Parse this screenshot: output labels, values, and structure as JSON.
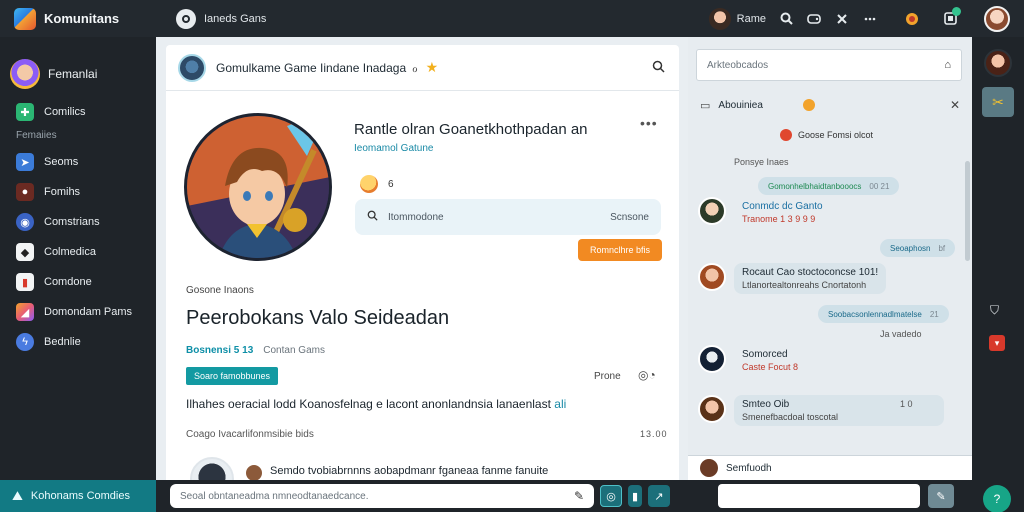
{
  "app": {
    "name": "Komunitans"
  },
  "top_tab": {
    "label": "Ianeds Gans"
  },
  "top_user": {
    "name": "Rame"
  },
  "top_icons": [
    "search-icon",
    "gamepad-icon",
    "share-icon",
    "grid-icon",
    "coin-icon",
    "notification-icon"
  ],
  "sidebar": {
    "profile_name": "Femanlai",
    "items": [
      {
        "label": "Comilics",
        "icon": "puzzle-icon",
        "color": "#2bb673"
      },
      {
        "section": "Femaiies"
      },
      {
        "label": "Seoms",
        "icon": "cursor-icon",
        "color": "#3b7bd8"
      },
      {
        "label": "Fomihs",
        "icon": "person-icon",
        "color": "#c0392b"
      },
      {
        "label": "Comstrians",
        "icon": "globe-icon",
        "color": "#3a63c4"
      },
      {
        "label": "Colmedica",
        "icon": "dice-icon",
        "color": "#f2f4f5"
      },
      {
        "label": "Comdone",
        "icon": "card-icon",
        "color": "#f2f4f5"
      },
      {
        "label": "Domondam Pams",
        "icon": "palette-icon",
        "color": "#e85d75"
      },
      {
        "label": "Bednlie",
        "icon": "bolt-icon",
        "color": "#4a7be0"
      }
    ]
  },
  "left_bottom": {
    "label": "Kohonams Comdies"
  },
  "card": {
    "header_title": "Gomulkame Game Iindane Inadaga",
    "game_title": "Rantle olran Goanetkhothpadan an",
    "game_subtitle": "Ieomamol Gatune",
    "reaction_count": "6",
    "search_placeholder": "Itommodone",
    "search_action": "Scnsone",
    "orange_button": "Romnclhre bfis",
    "section_label": "Gosone Inaons",
    "heading": "Peerobokans Valo Seideadan",
    "meta_primary": "Bosnensi 5 13",
    "meta_secondary": "Contan Gams",
    "tag": "Soaro famobbunes",
    "prone_label": "Prone",
    "paragraph": "Ilhahes oeracial lodd Koanosfelnag e lacont anonlandnsia lanaenlast",
    "paragraph_highlight": "ali",
    "section2_label": "Coago Ivacarlifonmsibie bids",
    "section2_meta": "13.00",
    "post_text": "Semdo tvobiabrnnns aobapdmanr fganeaa fanme fanuite"
  },
  "composer": {
    "placeholder": "Seoal obntaneadma nmneodtanaedcance."
  },
  "chat": {
    "search_placeholder": "Arkteobcados",
    "header_title": "Abouiniea",
    "alert_text": "Goose Fomsi olcot",
    "date": "Ponsye Inaes",
    "pills": [
      {
        "main": "Gomonhelbhaidtanbooocs",
        "meta": "00 21"
      },
      {
        "main": "Seoaphosn",
        "meta": "bf"
      },
      {
        "main": "Soobacsonlennadlmatelse",
        "meta": "21"
      }
    ],
    "messages": [
      {
        "name": "Conmdc dc Ganto",
        "sub": "Tranome 1 3 9 9 9"
      },
      {
        "name": "Rocaut Cao stoctoconcse 101!",
        "sub": "Ltlanortealtonreahs Cnortatonh"
      },
      {
        "name": "Somorced",
        "sub": "Caste  Focut 8"
      },
      {
        "name": "Smteo Oib",
        "sub": "Smenefbacdoal toscotal"
      },
      {
        "name": "Semfuodh",
        "sub": ""
      }
    ],
    "message_meta": [
      "",
      "",
      "",
      "1 0"
    ],
    "extra_sub": "Ja vadedo"
  },
  "colors": {
    "teal": "#139aa2",
    "orange": "#f28a22",
    "dark": "#1f2429",
    "link": "#1a8aa6"
  }
}
